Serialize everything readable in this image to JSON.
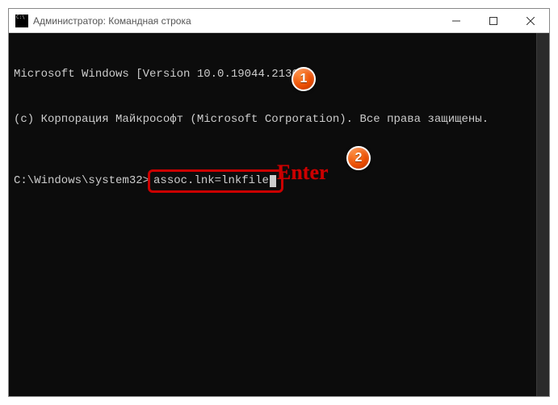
{
  "titlebar": {
    "title": "Администратор: Командная строка"
  },
  "terminal": {
    "line1": "Microsoft Windows [Version 10.0.19044.2130]",
    "line2": "(c) Корпорация Майкрософт (Microsoft Corporation). Все права защищены.",
    "prompt": "C:\\Windows\\system32>",
    "command": "assoc.lnk=lnkfile"
  },
  "annotations": {
    "badge1": "1",
    "badge2": "2",
    "enter_label": "Enter"
  }
}
